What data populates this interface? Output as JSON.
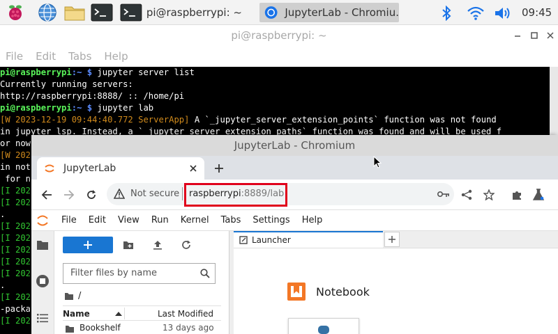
{
  "taskbar": {
    "tasks": [
      {
        "label": "pi@raspberrypi: ~"
      },
      {
        "label": "JupyterLab - Chromiu."
      }
    ],
    "clock": "09:45"
  },
  "terminal": {
    "title": "pi@raspberrypi: ~",
    "menu": [
      "File",
      "Edit",
      "Tabs",
      "Help"
    ],
    "prompt_user": "pi@raspberrypi",
    "prompt_path": ":~ $ ",
    "cmd1": "jupyter server list",
    "out1": "Currently running servers:",
    "out2": "http://raspberrypi:8888/ :: /home/pi",
    "cmd2": "jupyter lab",
    "warn_prefix": "[W 2023-12-19 09:44:40.772 ServerApp]",
    "warn_text": " A `_jupyter_server_extension_points` function was not found",
    "line7": "in jupyter_lsp. Instead, a `_jupyter_server_extension_paths` function was found and will be used f",
    "line8": "or now",
    "line9": "[W 202",
    "line10": "in not",
    "line11": " for n",
    "line12": "[I 202",
    "line13": "[I 202",
    "line14": ".",
    "line15": "[I 202",
    "line16": "[I 202",
    "line17": "[I 202",
    "line18": "[I 202",
    "line19": "[I 202",
    "line20": ".",
    "line21": "[I 202",
    "line22": "-packa",
    "line23": "[I 202"
  },
  "browser": {
    "window_title": "JupyterLab - Chromium",
    "tab_title": "JupyterLab",
    "not_secure": "Not secure",
    "url_host": "raspberrypi",
    "url_rest": ":8889/lab"
  },
  "jupyter": {
    "menu": [
      "File",
      "Edit",
      "View",
      "Run",
      "Kernel",
      "Tabs",
      "Settings",
      "Help"
    ],
    "filter_placeholder": "Filter files by name",
    "breadcrumb": "/",
    "col_name": "Name",
    "col_modified": "Last Modified",
    "file_row_name": "Bookshelf",
    "file_row_modified": "13 days ago",
    "launcher_tab": "Launcher",
    "launcher_section": "Notebook"
  },
  "colors": {
    "highlight_box": "#e0001b",
    "jupyter_orange": "#f37726",
    "jupyter_blue": "#1976d2"
  }
}
